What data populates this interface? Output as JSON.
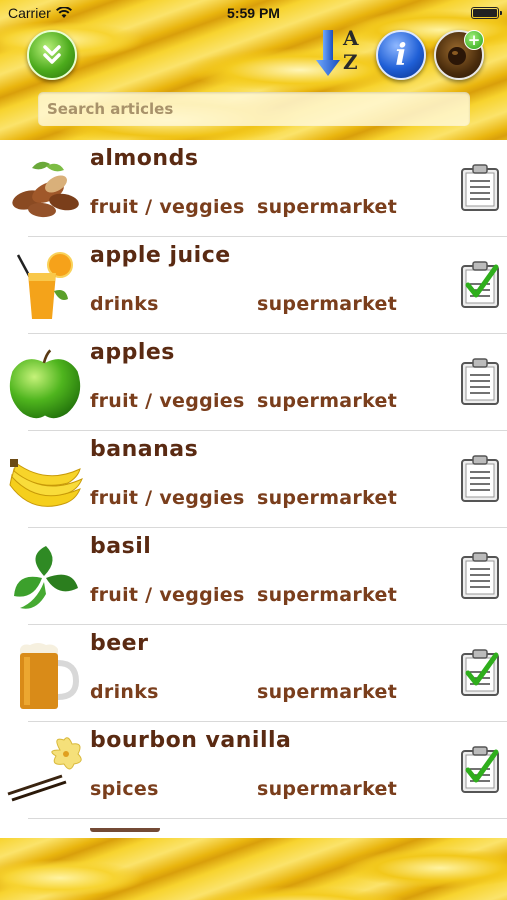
{
  "status_bar": {
    "carrier": "Carrier",
    "time": "5:59 PM"
  },
  "toolbar": {
    "expand_icon": "double-chevron-down-icon",
    "sort_icon": "sort-az-icon",
    "info_icon": "info-icon",
    "add_icon": "add-item-icon",
    "sort_letter_a": "A",
    "sort_letter_z": "Z",
    "info_glyph": "i",
    "add_badge": "+"
  },
  "search": {
    "placeholder": "Search articles"
  },
  "colors": {
    "item_name": "#5a2a12",
    "item_meta": "#7a3e1c",
    "check_green": "#2fae1c",
    "accent_yellow": "#f3c21a"
  },
  "items": [
    {
      "name": "almonds",
      "category": "fruit / veggies",
      "store": "supermarket",
      "image": "almonds",
      "checked": false
    },
    {
      "name": "apple juice",
      "category": "drinks",
      "store": "supermarket",
      "image": "apple-juice",
      "checked": true
    },
    {
      "name": "apples",
      "category": "fruit / veggies",
      "store": "supermarket",
      "image": "apple",
      "checked": false
    },
    {
      "name": "bananas",
      "category": "fruit / veggies",
      "store": "supermarket",
      "image": "bananas",
      "checked": false
    },
    {
      "name": "basil",
      "category": "fruit / veggies",
      "store": "supermarket",
      "image": "basil",
      "checked": false
    },
    {
      "name": "beer",
      "category": "drinks",
      "store": "supermarket",
      "image": "beer",
      "checked": true
    },
    {
      "name": "bourbon vanilla",
      "category": "spices",
      "store": "supermarket",
      "image": "vanilla",
      "checked": true
    }
  ]
}
